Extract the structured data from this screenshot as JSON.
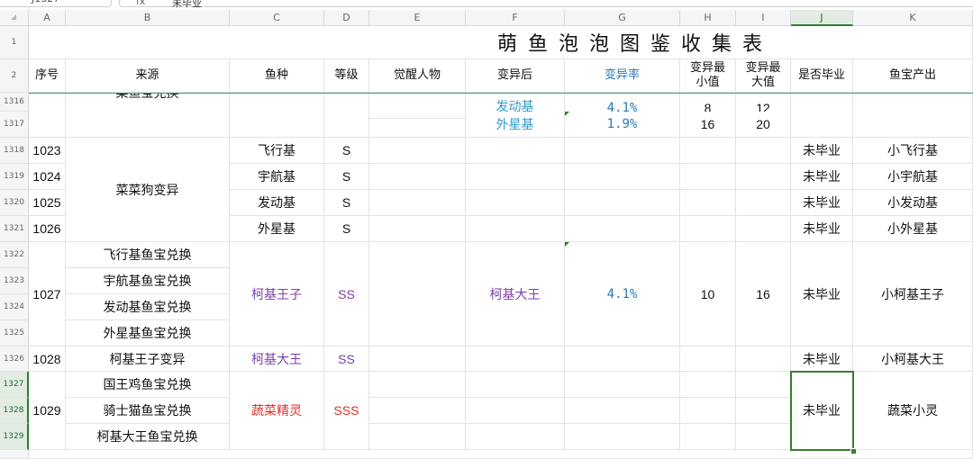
{
  "name_box": "J1327",
  "formula_label": "fx",
  "formula_value": "未毕业",
  "colors": {
    "accent_green": "#2e7d32",
    "blue_text": "#2a7ab8",
    "purple_text": "#7b3fa8",
    "red_text": "#e0302c",
    "freeze_line": "#2e9e8a"
  },
  "columns": [
    "A",
    "B",
    "C",
    "D",
    "E",
    "F",
    "G",
    "H",
    "I",
    "J",
    "K"
  ],
  "title": "萌鱼泡泡图鉴收集表",
  "headers": {
    "A": "序号",
    "B": "来源",
    "C": "鱼种",
    "D": "等级",
    "E": "觉醒人物",
    "F": "变异后",
    "G": "变异率",
    "H": "变异最小值",
    "I": "变异最大值",
    "J": "是否毕业",
    "K": "鱼宝产出"
  },
  "row_numbers": [
    "1",
    "2",
    "1316",
    "1317",
    "1318",
    "1319",
    "1320",
    "1321",
    "1322",
    "1323",
    "1324",
    "1325",
    "1326",
    "1327",
    "1328",
    "1329"
  ],
  "rows": {
    "r1316": {
      "B": "菜鱼宝兑换",
      "F": "发动基",
      "G": "4.1%",
      "H": "8",
      "I": "12"
    },
    "r1317": {
      "F": "外星基",
      "G": "1.9%",
      "H": "16",
      "I": "20"
    },
    "r1318": {
      "A": "1023",
      "C": "飞行基",
      "D": "S",
      "J": "未毕业",
      "K": "小飞行基"
    },
    "r1319": {
      "A": "1024",
      "C": "宇航基",
      "D": "S",
      "J": "未毕业",
      "K": "小宇航基"
    },
    "r1320": {
      "A": "1025",
      "C": "发动基",
      "D": "S",
      "J": "未毕业",
      "K": "小发动基"
    },
    "r1321": {
      "A": "1026",
      "C": "外星基",
      "D": "S",
      "J": "未毕业",
      "K": "小外星基"
    },
    "merged_b_1318": "菜菜狗变异",
    "g1027": {
      "A": "1027",
      "B": [
        "飞行基鱼宝兑换",
        "宇航基鱼宝兑换",
        "发动基鱼宝兑换",
        "外星基鱼宝兑换"
      ],
      "C": "柯基王子",
      "D": "SS",
      "F": "柯基大王",
      "G": "4.1%",
      "H": "10",
      "I": "16",
      "J": "未毕业",
      "K": "小柯基王子"
    },
    "r1326": {
      "A": "1028",
      "B": "柯基王子变异",
      "C": "柯基大王",
      "D": "SS",
      "J": "未毕业",
      "K": "小柯基大王"
    },
    "g1029": {
      "A": "1029",
      "B": [
        "国王鸡鱼宝兑换",
        "骑士猫鱼宝兑换",
        "柯基大王鱼宝兑换"
      ],
      "C": "蔬菜精灵",
      "D": "SSS",
      "J": "未毕业",
      "K": "蔬菜小灵"
    }
  }
}
